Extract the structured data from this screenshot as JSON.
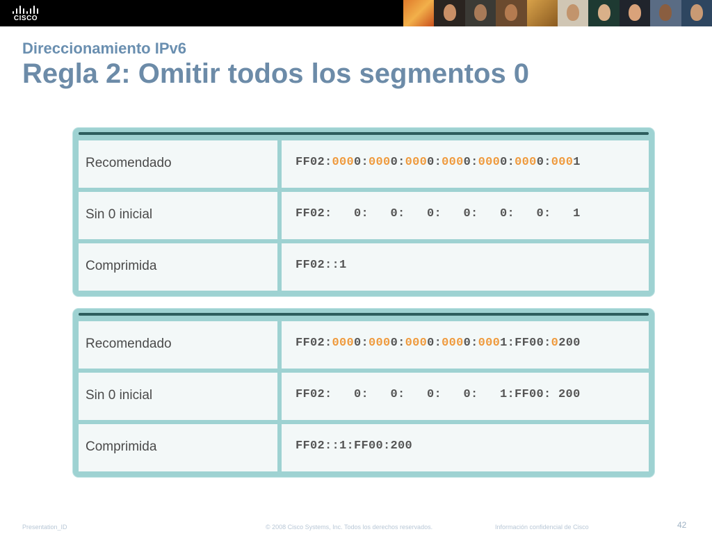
{
  "header": {
    "logo_text": "CISCO",
    "brand_color": "#000000"
  },
  "slide": {
    "subtitle": "Direccionamiento IPv6",
    "title": "Regla 2: Omitir todos los segmentos 0"
  },
  "tables": [
    {
      "rows": [
        {
          "label": "Recomendado",
          "address": [
            [
              "FF02:",
              ""
            ],
            [
              "000",
              "z"
            ],
            [
              "0:",
              ""
            ],
            [
              "000",
              "z"
            ],
            [
              "0:",
              ""
            ],
            [
              "000",
              "z"
            ],
            [
              "0:",
              ""
            ],
            [
              "000",
              "z"
            ],
            [
              "0:",
              ""
            ],
            [
              "000",
              "z"
            ],
            [
              "0:",
              ""
            ],
            [
              "000",
              "z"
            ],
            [
              "0:",
              ""
            ],
            [
              "000",
              "z"
            ],
            [
              "1",
              ""
            ]
          ]
        },
        {
          "label": "Sin 0 inicial",
          "address": [
            [
              "FF02:   0:   0:   0:   0:   0:   0:   1",
              ""
            ]
          ]
        },
        {
          "label": "Comprimida",
          "address": [
            [
              "FF02::1",
              ""
            ]
          ]
        }
      ]
    },
    {
      "rows": [
        {
          "label": "Recomendado",
          "address": [
            [
              "FF02:",
              ""
            ],
            [
              "000",
              "z"
            ],
            [
              "0:",
              ""
            ],
            [
              "000",
              "z"
            ],
            [
              "0:",
              ""
            ],
            [
              "000",
              "z"
            ],
            [
              "0:",
              ""
            ],
            [
              "000",
              "z"
            ],
            [
              "0:",
              ""
            ],
            [
              "000",
              "z"
            ],
            [
              "1:FF00:",
              ""
            ],
            [
              "0",
              "z"
            ],
            [
              "200",
              ""
            ]
          ]
        },
        {
          "label": "Sin 0 inicial",
          "address": [
            [
              "FF02:   0:   0:   0:   0:   1:FF00: 200",
              ""
            ]
          ]
        },
        {
          "label": "Comprimida",
          "address": [
            [
              "FF02::1:FF00:200",
              ""
            ]
          ]
        }
      ]
    }
  ],
  "colors": {
    "title": "#6c8ba8",
    "table_border": "#9ed2d2",
    "highlight_zero": "#ef9a3d"
  },
  "footer": {
    "left": "Presentation_ID",
    "center": "© 2008 Cisco Systems, Inc. Todos los derechos reservados.",
    "right": "Información confidencial de Cisco",
    "page_number": "42"
  }
}
